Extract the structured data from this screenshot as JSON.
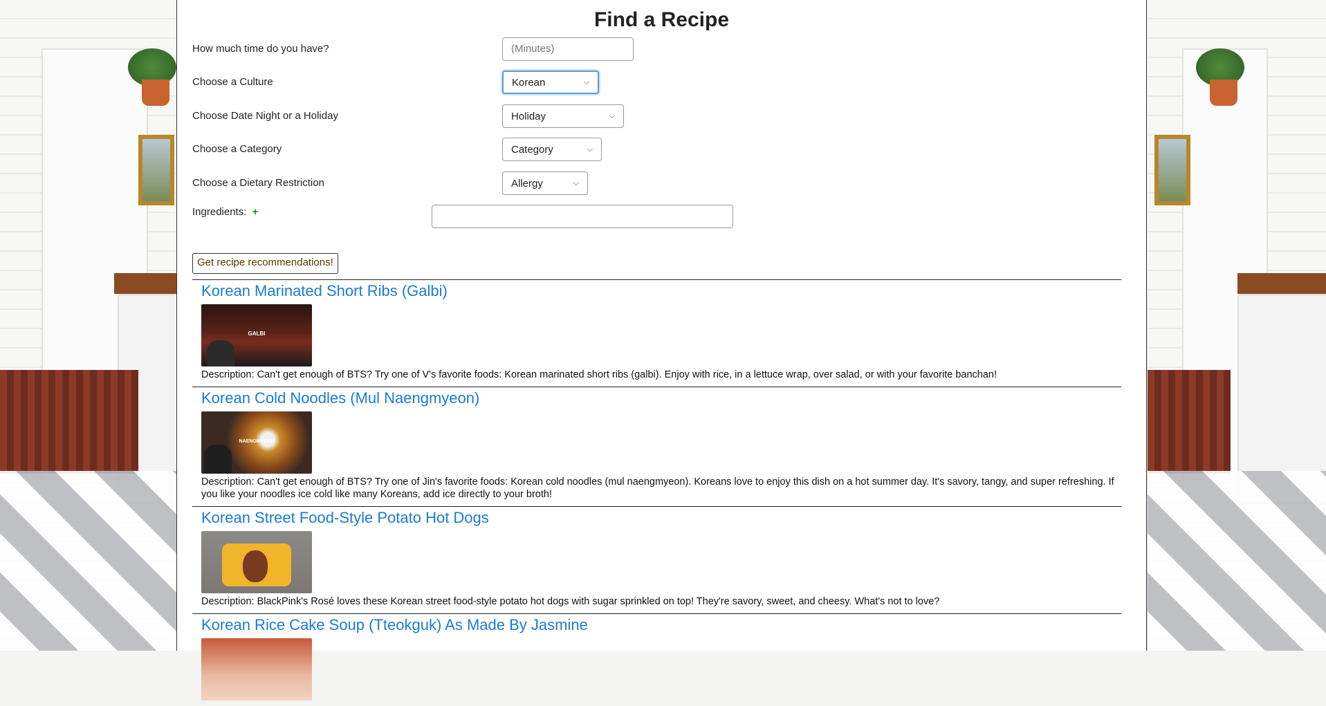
{
  "page": {
    "title": "Find a Recipe"
  },
  "form": {
    "time_label": "How much time do you have?",
    "time_placeholder": "(Minutes)",
    "culture_label": "Choose a Culture",
    "culture_value": "Korean",
    "occasion_label": "Choose Date Night or a Holiday",
    "occasion_value": "Holiday",
    "category_label": "Choose a Category",
    "category_value": "Category",
    "diet_label": "Choose a Dietary Restriction",
    "diet_value": "Allergy",
    "ingredients_label": "Ingredients:",
    "ingredients_add": "+",
    "ingredients_value": "",
    "submit_label": "Get recipe recommendations!"
  },
  "recipes": [
    {
      "title": "Korean Marinated Short Ribs (Galbi)",
      "thumb_text": "GALBI",
      "desc_label": "Description:",
      "desc": "Can't get enough of BTS? Try one of V's favorite foods: Korean marinated short ribs (galbi). Enjoy with rice, in a lettuce wrap, over salad, or with your favorite banchan!"
    },
    {
      "title": "Korean Cold Noodles (Mul Naengmyeon)",
      "thumb_text": "NAENGMYEON",
      "desc_label": "Description:",
      "desc": "Can't get enough of BTS? Try one of Jin's favorite foods: Korean cold noodles (mul naengmyeon). Koreans love to enjoy this dish on a hot summer day. It's savory, tangy, and super refreshing. If you like your noodles ice cold like many Koreans, add ice directly to your broth!"
    },
    {
      "title": "Korean Street Food-Style Potato Hot Dogs",
      "thumb_text": "",
      "desc_label": "Description:",
      "desc": "BlackPink's Rosé loves these Korean street food-style potato hot dogs with sugar sprinkled on top! They're savory, sweet, and cheesy. What's not to love?"
    },
    {
      "title": "Korean Rice Cake Soup (Tteokguk) As Made By Jasmine",
      "thumb_text": "",
      "desc_label": "",
      "desc": ""
    }
  ],
  "colors": {
    "link": "#1a7bd6",
    "add": "#1a8a1a",
    "focus": "#5b9bd5"
  },
  "icons": {
    "select_arrow": "chevron-down-icon"
  }
}
